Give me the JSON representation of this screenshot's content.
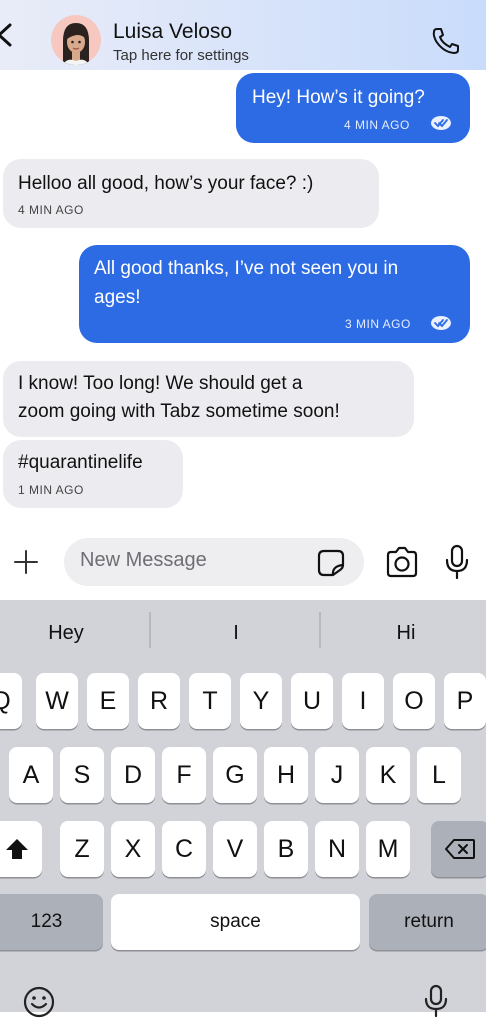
{
  "header": {
    "contact_name": "Luisa Veloso",
    "subtitle": "Tap here for settings"
  },
  "messages": [
    {
      "direction": "outgoing",
      "text": "Hey! How’s it going?",
      "time": "4 MIN AGO",
      "read": true
    },
    {
      "direction": "incoming",
      "text": "Helloo all good, how’s your face? :)",
      "time": "4 MIN AGO"
    },
    {
      "direction": "outgoing",
      "lines": [
        "All good thanks, I’ve not seen you in",
        "ages!"
      ],
      "time": "3 MIN AGO",
      "read": true
    },
    {
      "direction": "incoming",
      "lines": [
        "I know! Too long! We should get a",
        "zoom going with Tabz sometime soon!"
      ]
    },
    {
      "direction": "incoming",
      "text": "#quarantinelife",
      "time": "1 MIN AGO"
    }
  ],
  "composer": {
    "placeholder": "New Message"
  },
  "keyboard": {
    "suggestions": [
      "Hey",
      "I",
      "Hi"
    ],
    "row1": [
      "Q",
      "W",
      "E",
      "R",
      "T",
      "Y",
      "U",
      "I",
      "O",
      "P"
    ],
    "row2": [
      "A",
      "S",
      "D",
      "F",
      "G",
      "H",
      "J",
      "K",
      "L"
    ],
    "row3": [
      "Z",
      "X",
      "C",
      "V",
      "B",
      "N",
      "M"
    ],
    "numbers_label": "123",
    "space_label": "space",
    "return_label": "return"
  },
  "colors": {
    "outgoing_bubble": "#2d6be4",
    "incoming_bubble": "#ececf0",
    "keyboard_bg": "#d1d3d9"
  },
  "icons": [
    "back-chevron-icon",
    "phone-icon",
    "plus-icon",
    "sticker-icon",
    "camera-icon",
    "microphone-icon",
    "shift-icon",
    "backspace-icon",
    "emoji-icon",
    "dictation-icon"
  ]
}
